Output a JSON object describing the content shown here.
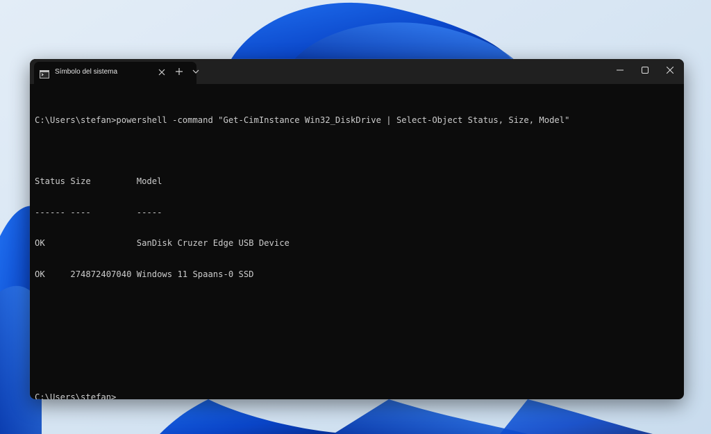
{
  "terminal": {
    "tab_title": "Símbolo del sistema",
    "icons": {
      "tab": "terminal-icon",
      "tab_close": "close-icon",
      "new_tab": "plus-icon",
      "dropdown": "chevron-down-icon",
      "minimize": "minimize-icon",
      "maximize": "maximize-icon",
      "close": "close-icon"
    },
    "lines": [
      "C:\\Users\\stefan>powershell -command \"Get-CimInstance Win32_DiskDrive | Select-Object Status, Size, Model\"",
      "",
      "Status Size         Model",
      "------ ----         -----",
      "OK                  SanDisk Cruzer Edge USB Device",
      "OK     274872407040 Windows 11 Spaans-0 SSD",
      "",
      "",
      "",
      "C:\\Users\\stefan>"
    ]
  },
  "colors": {
    "console_bg": "#0c0c0c",
    "console_text": "#cccccc",
    "titlebar_bg": "#202020"
  }
}
